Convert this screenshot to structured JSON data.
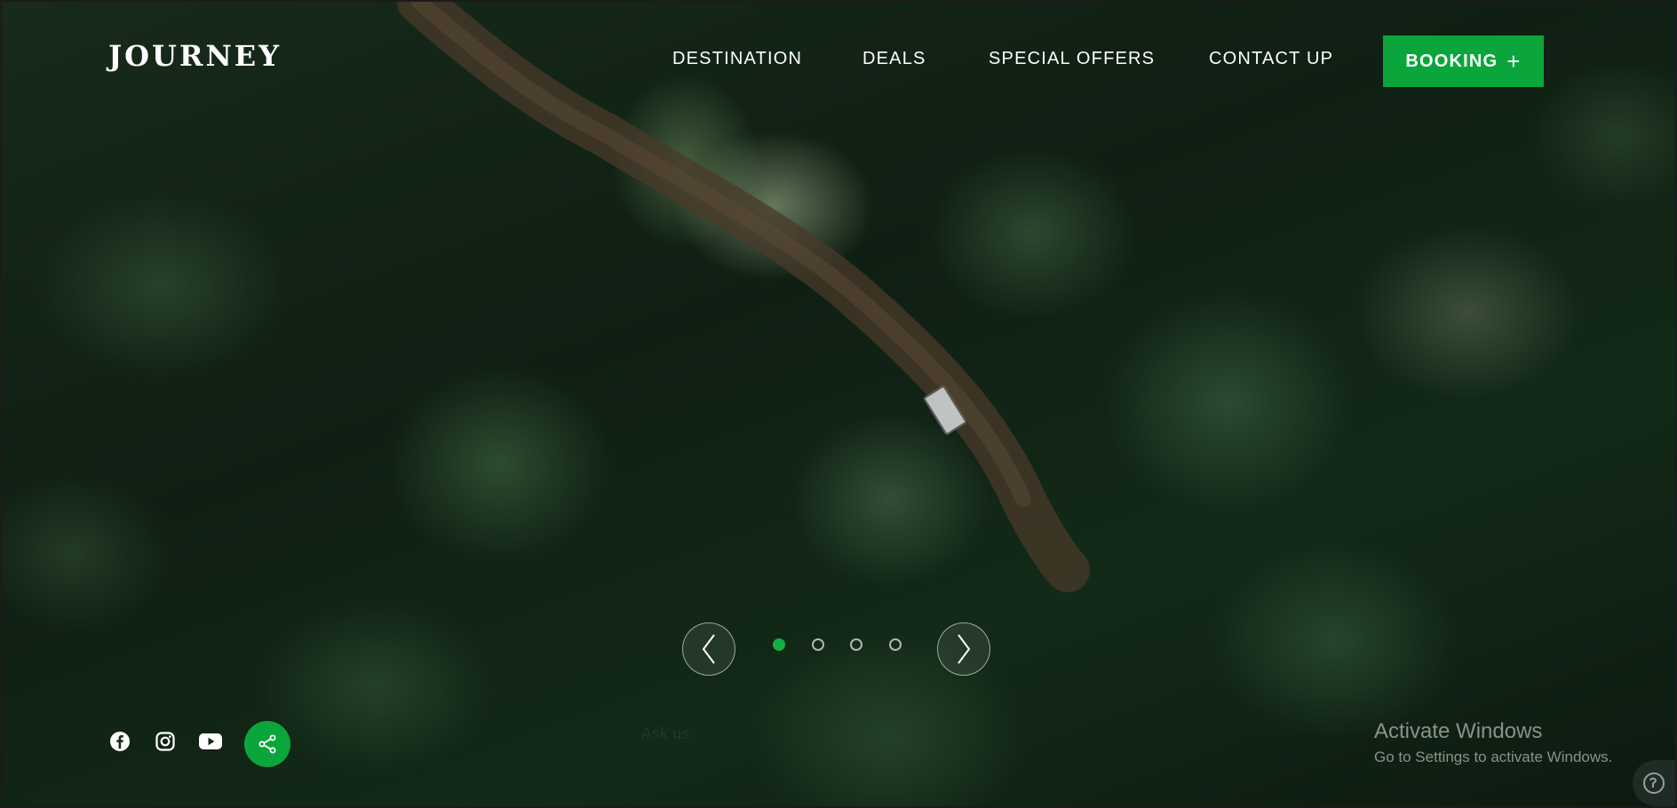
{
  "brand": {
    "logo": "JOURNEY"
  },
  "nav": {
    "items": [
      "DESTINATION",
      "DEALS",
      "SPECIAL OFFERS",
      "CONTACT UP"
    ],
    "booking_label": "BOOKING",
    "booking_icon": "plus-icon"
  },
  "carousel": {
    "slide_count": 4,
    "active_index": 0,
    "prev_icon": "chevron-left-icon",
    "next_icon": "chevron-right-icon"
  },
  "social": {
    "icons": [
      "facebook-icon",
      "instagram-icon",
      "youtube-icon"
    ],
    "share_icon": "share-icon"
  },
  "chat": {
    "label": "Ask us"
  },
  "watermark": {
    "title": "Activate Windows",
    "subtitle": "Go to Settings to activate Windows."
  },
  "colors": {
    "accent": "#0aa63c",
    "text": "#ffffff"
  }
}
